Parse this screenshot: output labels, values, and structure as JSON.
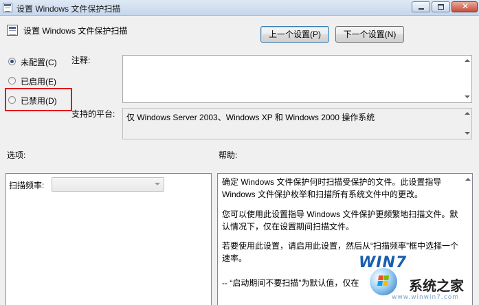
{
  "window": {
    "title": "设置 Windows 文件保护扫描",
    "close_glyph": "✕"
  },
  "header": {
    "title": "设置 Windows 文件保护扫描",
    "prev_button": "上一个设置(P)",
    "next_button": "下一个设置(N)"
  },
  "state_options": [
    {
      "label": "未配置(C)",
      "checked": true
    },
    {
      "label": "已启用(E)",
      "checked": false
    },
    {
      "label": "已禁用(D)",
      "checked": false
    }
  ],
  "comment": {
    "label": "注释:",
    "value": ""
  },
  "platform": {
    "label": "支持的平台:",
    "value": "仅 Windows Server 2003、Windows XP 和 Windows 2000 操作系统"
  },
  "options": {
    "label": "选项:",
    "scan_frequency_label": "扫描频率:",
    "scan_frequency_value": ""
  },
  "help": {
    "label": "帮助:",
    "paragraphs": [
      "确定 Windows 文件保护何时扫描受保护的文件。此设置指导 Windows 文件保护枚举和扫描所有系统文件中的更改。",
      "您可以使用此设置指导 Windows 文件保护更频繁地扫描文件。默认情况下，仅在设置期间扫描文件。",
      "若要使用此设置，请启用此设置，然后从“扫描频率”框中选择一个速率。",
      "-- “启动期间不要扫描”为默认值，仅在"
    ]
  },
  "watermark": {
    "brand": "WIN7",
    "site_name": "系统之家",
    "domain": "www.winwin7.com"
  }
}
